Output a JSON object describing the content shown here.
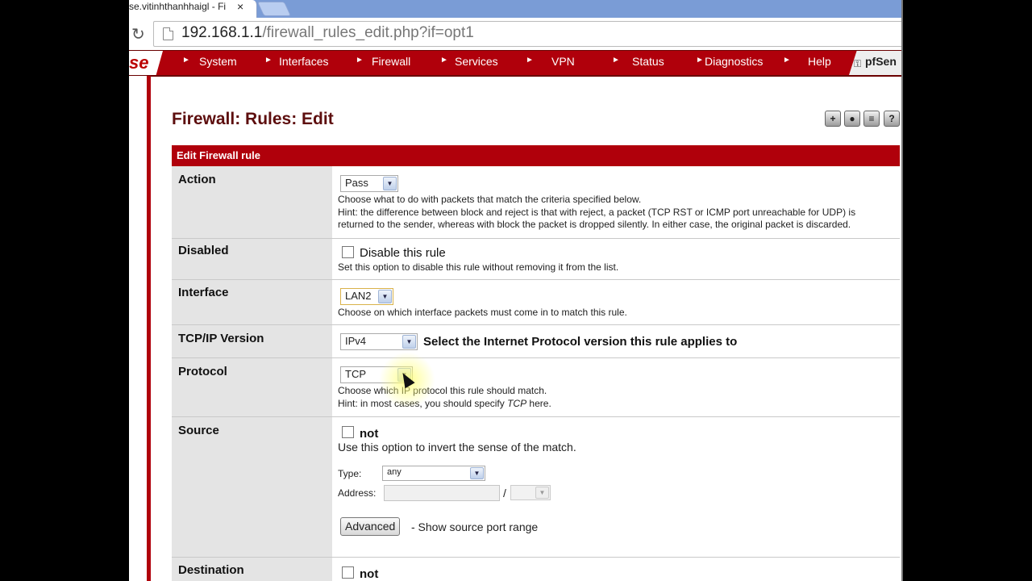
{
  "browser": {
    "tab_title": "se.vitinhthanhhaigl - Fi",
    "tab_close": "×",
    "url_host": "192.168.1.1",
    "url_path": "/firewall_rules_edit.php?if=opt1"
  },
  "nav": {
    "logo": "se",
    "items": [
      "System",
      "Interfaces",
      "Firewall",
      "Services",
      "VPN",
      "Status",
      "Diagnostics",
      "Help"
    ],
    "brand": "pfSen"
  },
  "page": {
    "title": "Firewall: Rules: Edit",
    "header_icons": [
      "add-icon",
      "record-icon",
      "list-icon",
      "help-icon"
    ],
    "help_glyph": "?"
  },
  "form": {
    "heading": "Edit Firewall rule",
    "action": {
      "label": "Action",
      "value": "Pass",
      "help1": "Choose what to do with packets that match the criteria specified below.",
      "help2": "Hint: the difference between block and reject is that with reject, a packet (TCP RST or ICMP port unreachable for UDP) is",
      "help3": "returned to the sender, whereas with block the packet is dropped silently. In either case, the original packet is discarded."
    },
    "disabled": {
      "label": "Disabled",
      "checkbox_label": "Disable this rule",
      "help": "Set this option to disable this rule without removing it from the list."
    },
    "interface": {
      "label": "Interface",
      "value": "LAN2",
      "help": "Choose on which interface packets must come in to match this rule."
    },
    "ipversion": {
      "label": "TCP/IP Version",
      "value": "IPv4",
      "help": "Select the Internet Protocol version this rule applies to"
    },
    "protocol": {
      "label": "Protocol",
      "value": "TCP",
      "help1": "Choose which IP protocol this rule should match.",
      "help2_pre": "Hint: in most cases, you should specify ",
      "help2_em": "TCP",
      "help2_post": " here."
    },
    "source": {
      "label": "Source",
      "not_label": "not",
      "help": "Use this option to invert the sense of the match.",
      "type_label": "Type:",
      "type_value": "any",
      "address_label": "Address:",
      "slash": "/",
      "advanced_button": "Advanced",
      "advanced_help": "- Show source port range"
    },
    "destination": {
      "label": "Destination",
      "not_label": "not"
    }
  },
  "colors": {
    "nav_red": "#b0000b",
    "title_maroon": "#5d0e0e"
  }
}
